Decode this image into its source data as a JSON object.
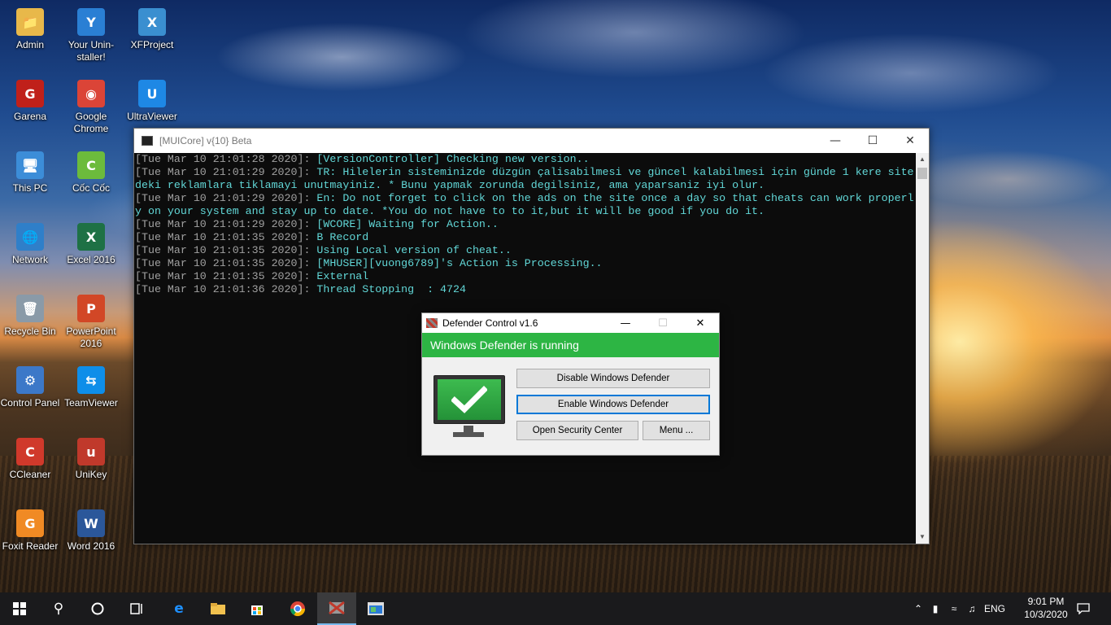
{
  "desktop": {
    "icons": [
      {
        "label": "Admin",
        "glyph": "📁",
        "color": "#e8b84a"
      },
      {
        "label": "Your Unin-staller!",
        "glyph": "Y",
        "color": "#2a7fd4"
      },
      {
        "label": "XFProject",
        "glyph": "X",
        "color": "#3a8fd0"
      },
      {
        "label": "Garena",
        "glyph": "G",
        "color": "#c0201a"
      },
      {
        "label": "Google Chrome",
        "glyph": "◉",
        "color": "#db4437"
      },
      {
        "label": "UltraViewer",
        "glyph": "U",
        "color": "#1e88e5"
      },
      {
        "label": "This PC",
        "glyph": "🖥",
        "color": "#3c8dd8"
      },
      {
        "label": "Cốc Cốc",
        "glyph": "C",
        "color": "#6cbb3c"
      },
      {
        "label": "Network",
        "glyph": "🌐",
        "color": "#2f7fc9"
      },
      {
        "label": "Excel 2016",
        "glyph": "X",
        "color": "#1e7145"
      },
      {
        "label": "Recycle Bin",
        "glyph": "🗑",
        "color": "#8a9aa8"
      },
      {
        "label": "PowerPoint 2016",
        "glyph": "P",
        "color": "#d24726"
      },
      {
        "label": "Control Panel",
        "glyph": "⚙",
        "color": "#3c78c8"
      },
      {
        "label": "TeamViewer",
        "glyph": "⇆",
        "color": "#0e8ee9"
      },
      {
        "label": "CCleaner",
        "glyph": "C",
        "color": "#d0392b"
      },
      {
        "label": "UniKey",
        "glyph": "u",
        "color": "#c0392b"
      },
      {
        "label": "Foxit Reader",
        "glyph": "G",
        "color": "#f08a24"
      },
      {
        "label": "Word 2016",
        "glyph": "W",
        "color": "#2b579a"
      }
    ]
  },
  "console": {
    "title": "[MUICore] v{10} Beta",
    "lines": [
      {
        "ts": "[Tue Mar 10 21:01:28 2020]:",
        "msg": " [VersionController] Checking new version.."
      },
      {
        "ts": "[Tue Mar 10 21:01:29 2020]:",
        "msg": " TR: Hilelerin sisteminizde düzgün çalisabilmesi ve güncel kalabilmesi için günde 1 kere site"
      },
      {
        "ts": "",
        "msg": "deki reklamlara tiklamayi unutmayiniz. * Bunu yapmak zorunda degilsiniz, ama yaparsaniz iyi olur."
      },
      {
        "ts": "[Tue Mar 10 21:01:29 2020]:",
        "msg": " En: Do not forget to click on the ads on the site once a day so that cheats can work properl"
      },
      {
        "ts": "",
        "msg": "y on your system and stay up to date. *You do not have to to it,but it will be good if you do it."
      },
      {
        "ts": "[Tue Mar 10 21:01:29 2020]:",
        "msg": " [WCORE] Waiting for Action.."
      },
      {
        "ts": "[Tue Mar 10 21:01:35 2020]:",
        "msg": " B Record"
      },
      {
        "ts": "[Tue Mar 10 21:01:35 2020]:",
        "msg": " Using Local version of cheat.."
      },
      {
        "ts": "[Tue Mar 10 21:01:35 2020]:",
        "msg": " [MHUSER][vuong6789]'s Action is Processing.."
      },
      {
        "ts": "[Tue Mar 10 21:01:35 2020]:",
        "msg": " External"
      },
      {
        "ts": "[Tue Mar 10 21:01:36 2020]:",
        "msg": " Thread Stopping  : 4724"
      }
    ]
  },
  "defender": {
    "title": "Defender Control v1.6",
    "status": "Windows Defender is running",
    "status_color": "#2db544",
    "buttons": {
      "disable": "Disable Windows Defender",
      "enable": "Enable Windows Defender",
      "security_center": "Open Security Center",
      "menu": "Menu ..."
    }
  },
  "taskbar": {
    "language": "ENG",
    "time": "9:01 PM",
    "date": "10/3/2020"
  }
}
